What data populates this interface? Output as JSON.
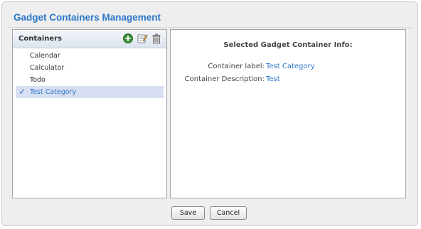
{
  "window": {
    "title": "Gadget Containers Management"
  },
  "containers": {
    "header_label": "Containers",
    "icons": {
      "add": "add-icon",
      "edit": "edit-icon",
      "delete": "trash-icon"
    },
    "items": [
      {
        "label": "Calendar",
        "selected": false
      },
      {
        "label": "Calculator",
        "selected": false
      },
      {
        "label": "Todo",
        "selected": false
      },
      {
        "label": "Test Category",
        "selected": true
      }
    ],
    "check_glyph": "✓"
  },
  "info": {
    "title": "Selected Gadget Container Info:",
    "label_caption": "Container label:",
    "label_value": "Test Category",
    "description_caption": "Container Description:",
    "description_value": "Test"
  },
  "footer": {
    "save_label": "Save",
    "cancel_label": "Cancel"
  },
  "colors": {
    "accent": "#2b77c9",
    "selected_bg": "#d8dff2"
  }
}
